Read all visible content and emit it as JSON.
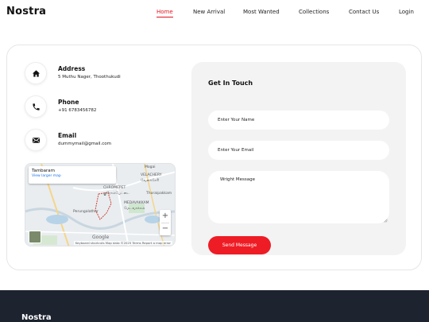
{
  "header": {
    "brand": "Nostra",
    "nav": [
      {
        "label": "Home",
        "active": true
      },
      {
        "label": "New Arrival",
        "active": false
      },
      {
        "label": "Most Wanted",
        "active": false
      },
      {
        "label": "Collections",
        "active": false
      },
      {
        "label": "Contact Us",
        "active": false
      },
      {
        "label": "Login",
        "active": false
      }
    ]
  },
  "contact": {
    "address": {
      "title": "Address",
      "value": "5 Muthu Nager, Thoothukudi",
      "icon": "home-icon"
    },
    "phone": {
      "title": "Phone",
      "value": "+91 6783456782",
      "icon": "phone-icon"
    },
    "email": {
      "title": "Email",
      "value": "dummymail@gmail.com",
      "icon": "envelope-icon"
    }
  },
  "map": {
    "place": "Tambaram",
    "link": "View larger map",
    "labels": [
      "VELACHERY",
      "வேளச்சேரி",
      "CHROMEPET",
      "குரோம்பேட்டை",
      "MEDAVAKKAM",
      "மேடவாக்கம்",
      "Thoraipakkam",
      "Perungalathur",
      "Mogai"
    ],
    "google": "Google",
    "footer": "Keyboard shortcuts   Map data ©2025   Terms   Report a map error",
    "zoom_in": "+",
    "zoom_out": "−"
  },
  "form": {
    "title": "Get In Touch",
    "name_placeholder": "Enter Your Name",
    "email_placeholder": "Enter Your Email",
    "message_placeholder": "Wright Message",
    "button": "Send Message"
  },
  "footer": {
    "brand": "Nostra"
  },
  "colors": {
    "accent": "#ee1c25",
    "footer_bg": "#1e2330",
    "panel_bg": "#f3f3f3"
  }
}
